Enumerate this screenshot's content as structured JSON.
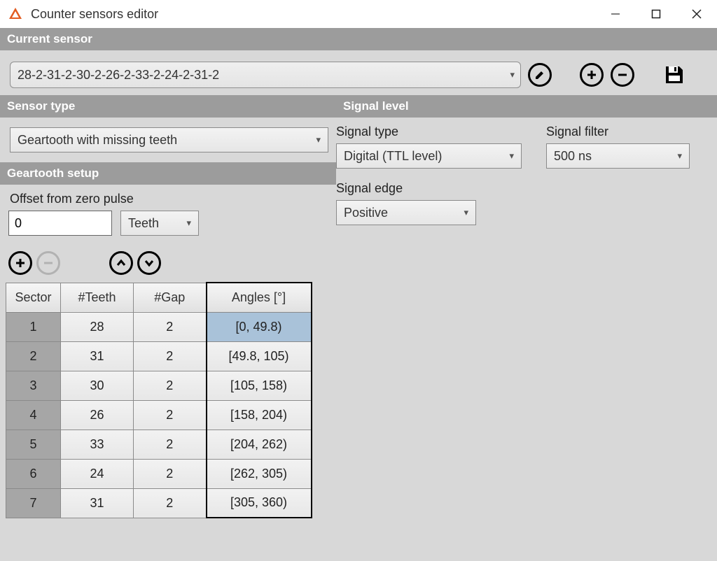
{
  "window": {
    "title": "Counter sensors editor"
  },
  "current_sensor": {
    "header": "Current sensor",
    "value": "28-2-31-2-30-2-26-2-33-2-24-2-31-2"
  },
  "sensor_type": {
    "header": "Sensor type",
    "value": "Geartooth with missing teeth"
  },
  "signal_level": {
    "header": "Signal level",
    "signal_type_label": "Signal type",
    "signal_type_value": "Digital (TTL level)",
    "signal_filter_label": "Signal filter",
    "signal_filter_value": "500 ns",
    "signal_edge_label": "Signal edge",
    "signal_edge_value": "Positive"
  },
  "geartooth_setup": {
    "header": "Geartooth setup",
    "offset_label": "Offset from zero pulse",
    "offset_value": "0",
    "offset_unit": "Teeth"
  },
  "table": {
    "headers": {
      "sector": "Sector",
      "teeth": "#Teeth",
      "gap": "#Gap",
      "angles": "Angles [°]"
    },
    "rows": [
      {
        "sector": "1",
        "teeth": "28",
        "gap": "2",
        "angles": "[0, 49.8)"
      },
      {
        "sector": "2",
        "teeth": "31",
        "gap": "2",
        "angles": "[49.8, 105)"
      },
      {
        "sector": "3",
        "teeth": "30",
        "gap": "2",
        "angles": "[105, 158)"
      },
      {
        "sector": "4",
        "teeth": "26",
        "gap": "2",
        "angles": "[158, 204)"
      },
      {
        "sector": "5",
        "teeth": "33",
        "gap": "2",
        "angles": "[204, 262)"
      },
      {
        "sector": "6",
        "teeth": "24",
        "gap": "2",
        "angles": "[262, 305)"
      },
      {
        "sector": "7",
        "teeth": "31",
        "gap": "2",
        "angles": "[305, 360)"
      }
    ]
  }
}
